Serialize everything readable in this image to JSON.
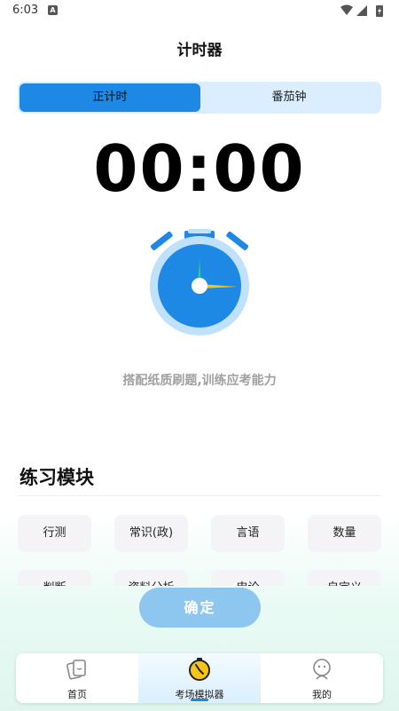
{
  "status": {
    "time": "6:03",
    "notification_icon": "A"
  },
  "header": {
    "title": "计时器"
  },
  "segment": {
    "tabs": [
      "正计时",
      "番茄钟"
    ],
    "active": 0
  },
  "timer": {
    "display": "00:00"
  },
  "hint": "搭配纸质刷题,训练应考能力",
  "practice": {
    "title": "练习模块",
    "modules": [
      "行测",
      "常识(政)",
      "言语",
      "数量",
      "判断",
      "资料分析",
      "申论",
      "自定义"
    ]
  },
  "confirm_label": "确定",
  "tabbar": {
    "items": [
      {
        "label": "首页",
        "icon": "cards-icon"
      },
      {
        "label": "考场模拟器",
        "icon": "stopwatch-icon"
      },
      {
        "label": "我的",
        "icon": "profile-icon"
      }
    ],
    "active": 1
  },
  "colors": {
    "accent": "#1e88e5",
    "segment_bg": "#dbeeff",
    "button": "#8dc6ee",
    "clock_face": "#1e88e5",
    "clock_ring": "#bfe1fb"
  }
}
